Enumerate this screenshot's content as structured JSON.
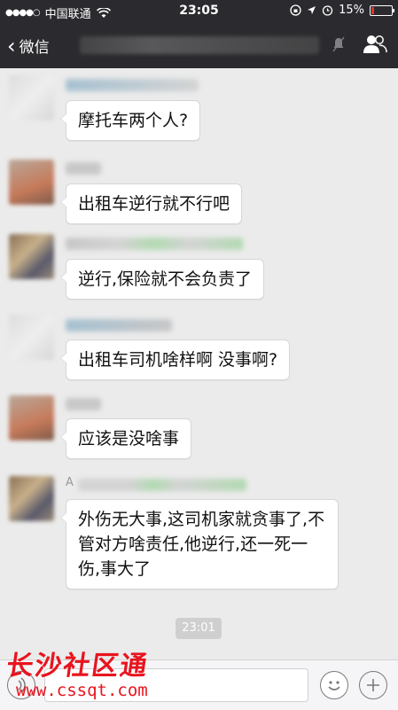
{
  "status_bar": {
    "signal": "●●●●○",
    "carrier": "中国联通",
    "time": "23:05",
    "battery": "15%",
    "battery_level": 0.15
  },
  "nav": {
    "back_label": "微信",
    "title": ""
  },
  "messages": [
    {
      "text": "摩托车两个人?"
    },
    {
      "text": "出租车逆行就不行吧"
    },
    {
      "text": "逆行,保险就不会负责了"
    },
    {
      "text": "出租车司机啥样啊 没事啊?"
    },
    {
      "text": "应该是没啥事"
    },
    {
      "sender_initial": "A",
      "text": "外伤无大事,这司机家就贪事了,不管对方啥责任,他逆行,还一死一伤,事大了"
    }
  ],
  "timestamp": "23:01",
  "watermark": {
    "title": "长沙社区通",
    "url": "www.cssqt.com"
  },
  "colors": {
    "header_bg": "#2b2b2f",
    "chat_bg": "#ebebeb",
    "bubble_bg": "#ffffff",
    "watermark": "#e8141e"
  }
}
